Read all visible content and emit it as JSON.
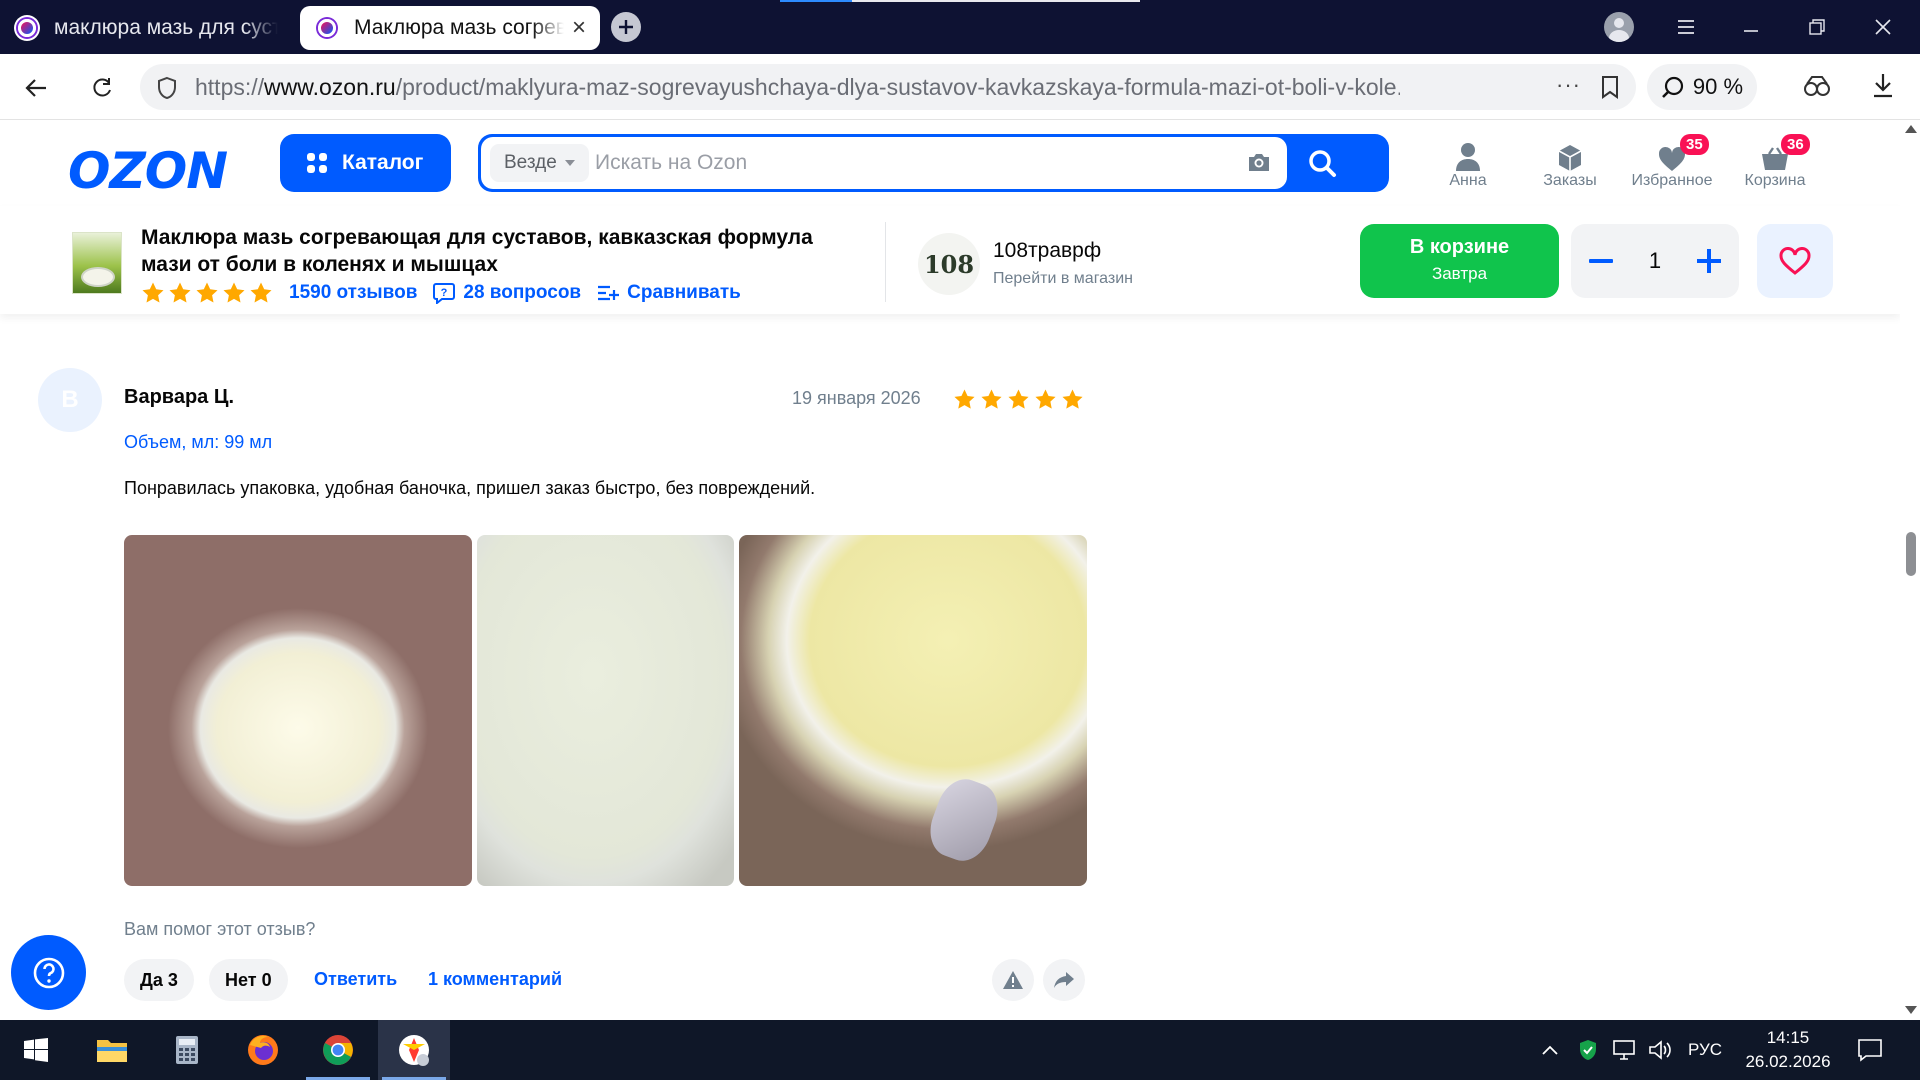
{
  "browser": {
    "tabs": [
      {
        "title": "маклюра мазь для суставов"
      },
      {
        "title": "Маклюра мазь согревающая для суставов"
      }
    ],
    "url": {
      "scheme": "https://",
      "host": "www.ozon.ru",
      "path": "/product/maklyura-maz-sogrevayushchaya-dlya-sustavov-kavkazskaya-formula-mazi-ot-boli-v-kole..."
    },
    "zoom": "90 %",
    "tab_close_glyph": "×",
    "url_more_glyph": "···"
  },
  "ozon": {
    "logo": "OZON",
    "catalog_label": "Каталог",
    "search_scope": "Везде",
    "search_placeholder": "Искать на Ozon",
    "header_icons": [
      {
        "label": "Анна",
        "icon": "user-icon"
      },
      {
        "label": "Заказы",
        "icon": "box-icon"
      },
      {
        "label": "Избранное",
        "icon": "heart-icon",
        "badge": "35"
      },
      {
        "label": "Корзина",
        "icon": "cart-icon",
        "badge": "36"
      }
    ]
  },
  "product": {
    "title": "Маклюра мазь согревающая для суставов, кавказская формула мази от боли в коленях и мышцах",
    "rating_stars": 5,
    "reviews_label": "1590 отзывов",
    "questions_label": "28 вопросов",
    "compare_label": "Сравнивать",
    "shop": {
      "name": "108травpф",
      "link_label": "Перейти в магазин",
      "logo_text": "108"
    },
    "cart": {
      "label": "В корзине",
      "sub": "Завтра"
    },
    "quantity": "1",
    "colors": {
      "accent": "#005bff",
      "cart_green": "#10c44c",
      "star": "#ffa800",
      "badge": "#f91155"
    }
  },
  "review": {
    "avatar_letter": "В",
    "author": "Варвара Ц.",
    "date": "19 января 2026",
    "stars": 5,
    "variant": "Объем, мл: 99 мл",
    "text": "Понравилась упаковка, удобная баночка, пришел заказ быстро, без повреждений.",
    "photos": [
      "jar-top-view",
      "jar-close-up",
      "jar-in-hand"
    ],
    "helpful_question": "Вам помог этот отзыв?",
    "yes_label": "Да 3",
    "no_label": "Нет 0",
    "reply_label": "Ответить",
    "comments_label": "1 комментарий"
  },
  "taskbar": {
    "apps": [
      "windows-start",
      "file-explorer",
      "calculator",
      "firefox",
      "chrome",
      "yandex-browser"
    ],
    "lang": "РУС",
    "time": "14:15",
    "date": "26.02.2026"
  }
}
